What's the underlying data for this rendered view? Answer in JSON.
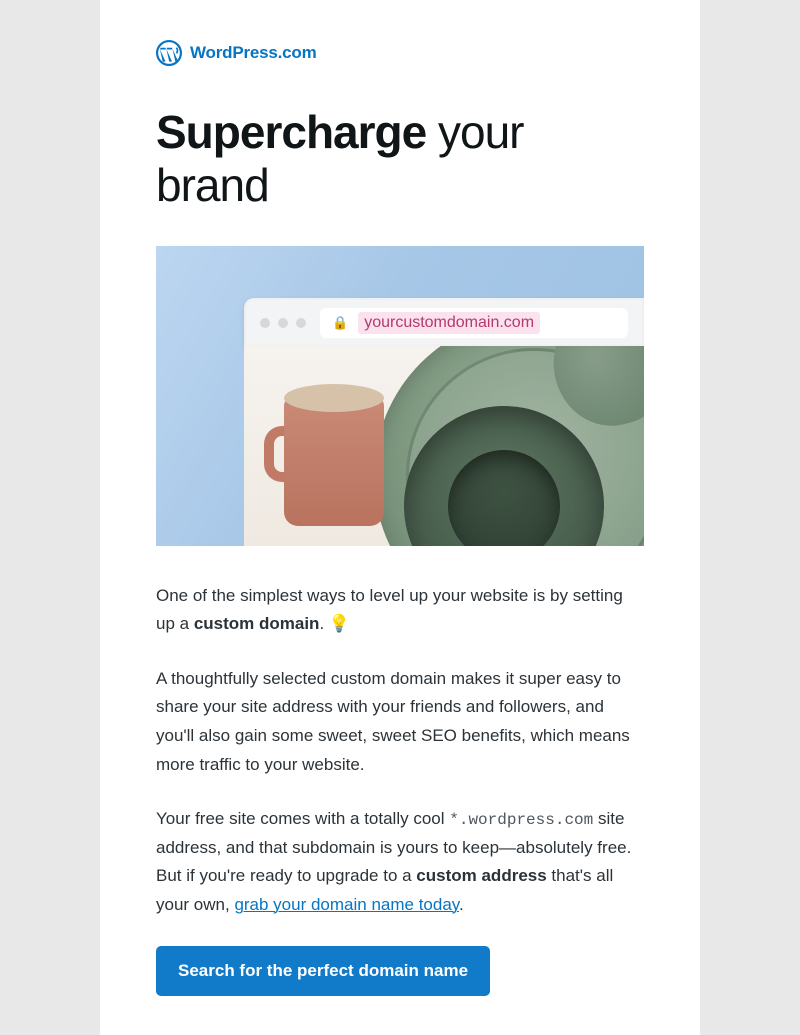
{
  "brand": {
    "name": "WordPress.com",
    "logo_color": "#0675c4"
  },
  "headline": {
    "bold": "Supercharge",
    "rest": " your brand"
  },
  "hero": {
    "url_display": "yourcustomdomain.com"
  },
  "paragraphs": {
    "p1_pre": "One of the simplest ways to level up your website is by setting up a ",
    "p1_bold": "custom domain",
    "p1_post": ". 💡",
    "p2": "A thoughtfully selected custom domain makes it super easy to share your site address with your friends and followers, and you'll also gain some sweet, sweet SEO benefits, which means more traffic to your website.",
    "p3_pre": "Your free site comes with a totally cool ",
    "p3_mono": "*.wordpress.com",
    "p3_mid": " site address, and that subdomain is yours to keep—absolutely free. But if you're ready to upgrade to a ",
    "p3_bold": "custom address",
    "p3_post": " that's all your own, ",
    "p3_link": "grab your domain name today",
    "p3_end": "."
  },
  "cta": {
    "label": "Search for the perfect domain name"
  }
}
